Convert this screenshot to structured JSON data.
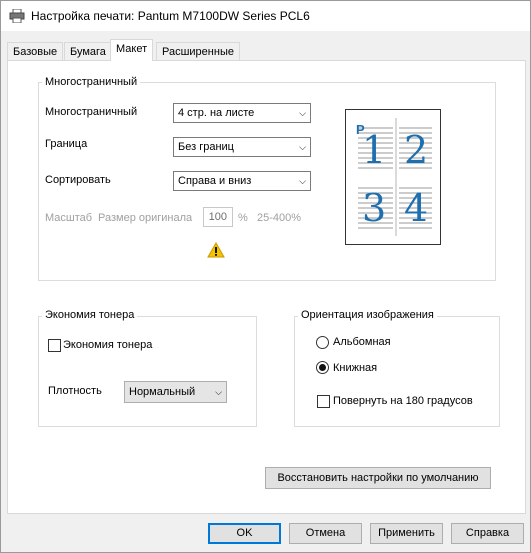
{
  "window": {
    "title": "Настройка печати: Pantum M7100DW Series PCL6"
  },
  "tabs": [
    {
      "label": "Базовые"
    },
    {
      "label": "Бумага"
    },
    {
      "label": "Макет"
    },
    {
      "label": "Расширенные"
    }
  ],
  "multipage": {
    "group_label": "Многостраничный",
    "pages_label": "Многостраничный",
    "pages_value": "4 стр. на листе",
    "border_label": "Граница",
    "border_value": "Без границ",
    "sort_label": "Сортировать",
    "sort_value": "Справа и вниз",
    "scale_label": "Масштаб",
    "scale_sub_label": "Размер оригинала",
    "scale_value": "100",
    "scale_unit": "%",
    "scale_range": "25-400%",
    "preview_corner": "P",
    "preview_digits": [
      "1",
      "2",
      "3",
      "4"
    ]
  },
  "toner": {
    "group_label": "Экономия тонера",
    "checkbox_label": "Экономия тонера",
    "density_label": "Плотность",
    "density_value": "Нормальный"
  },
  "orientation": {
    "group_label": "Ориентация изображения",
    "landscape_label": "Альбомная",
    "portrait_label": "Книжная",
    "rotate_label": "Повернуть на 180 градусов"
  },
  "restore_button": "Восстановить настройки по умолчанию",
  "footer": {
    "ok": "OK",
    "cancel": "Отмена",
    "apply": "Применить",
    "help": "Справка"
  },
  "colors": {
    "accent": "#0078d7",
    "preview_digit": "#1e6fb0",
    "warning": "#f5c400"
  }
}
